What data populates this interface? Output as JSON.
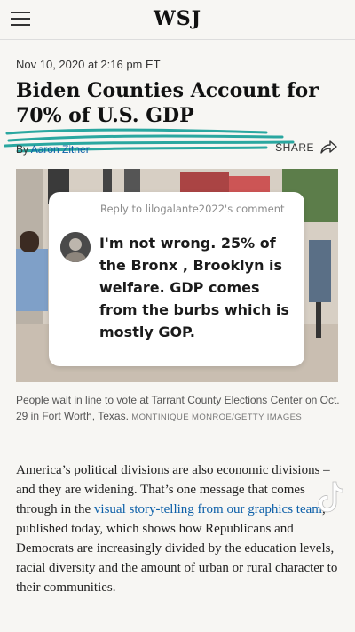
{
  "header": {
    "logo": "WSJ",
    "menu_icon": "hamburger-menu-icon"
  },
  "article": {
    "date": "Nov 10, 2020 at 2:16 pm ET",
    "headline": "Biden Counties Account for 70% of U.S. GDP",
    "byline_prefix": "By ",
    "author": "Aaron Zitner",
    "share_label": "SHARE"
  },
  "comment": {
    "reply_to": "Reply to lilogalante2022's comment",
    "text": "I'm not wrong. 25% of the Bronx , Brooklyn is welfare. GDP comes from the burbs which is mostly GOP."
  },
  "caption": {
    "text": "People wait in line to vote at Tarrant County Elections Center on Oct. 29 in Fort Worth, Texas. ",
    "credit": "MONTINIQUE MONROE/GETTY IMAGES"
  },
  "body": {
    "p1_start": "America’s political divisions are also economic divisions – and they are widening. That’s one message that comes through in the ",
    "p1_link": "visual story-telling from our graphics team",
    "p1_end": ", published today, which shows how Republicans and Democrats are increasingly divided by the education levels, racial diversity and the amount of urban or rural character to their communities."
  },
  "overlay": {
    "watermark": "tiktok-logo-icon"
  },
  "colors": {
    "link": "#0c5fa8",
    "scribble": "#2aa7a0",
    "background": "#f7f6f3"
  }
}
